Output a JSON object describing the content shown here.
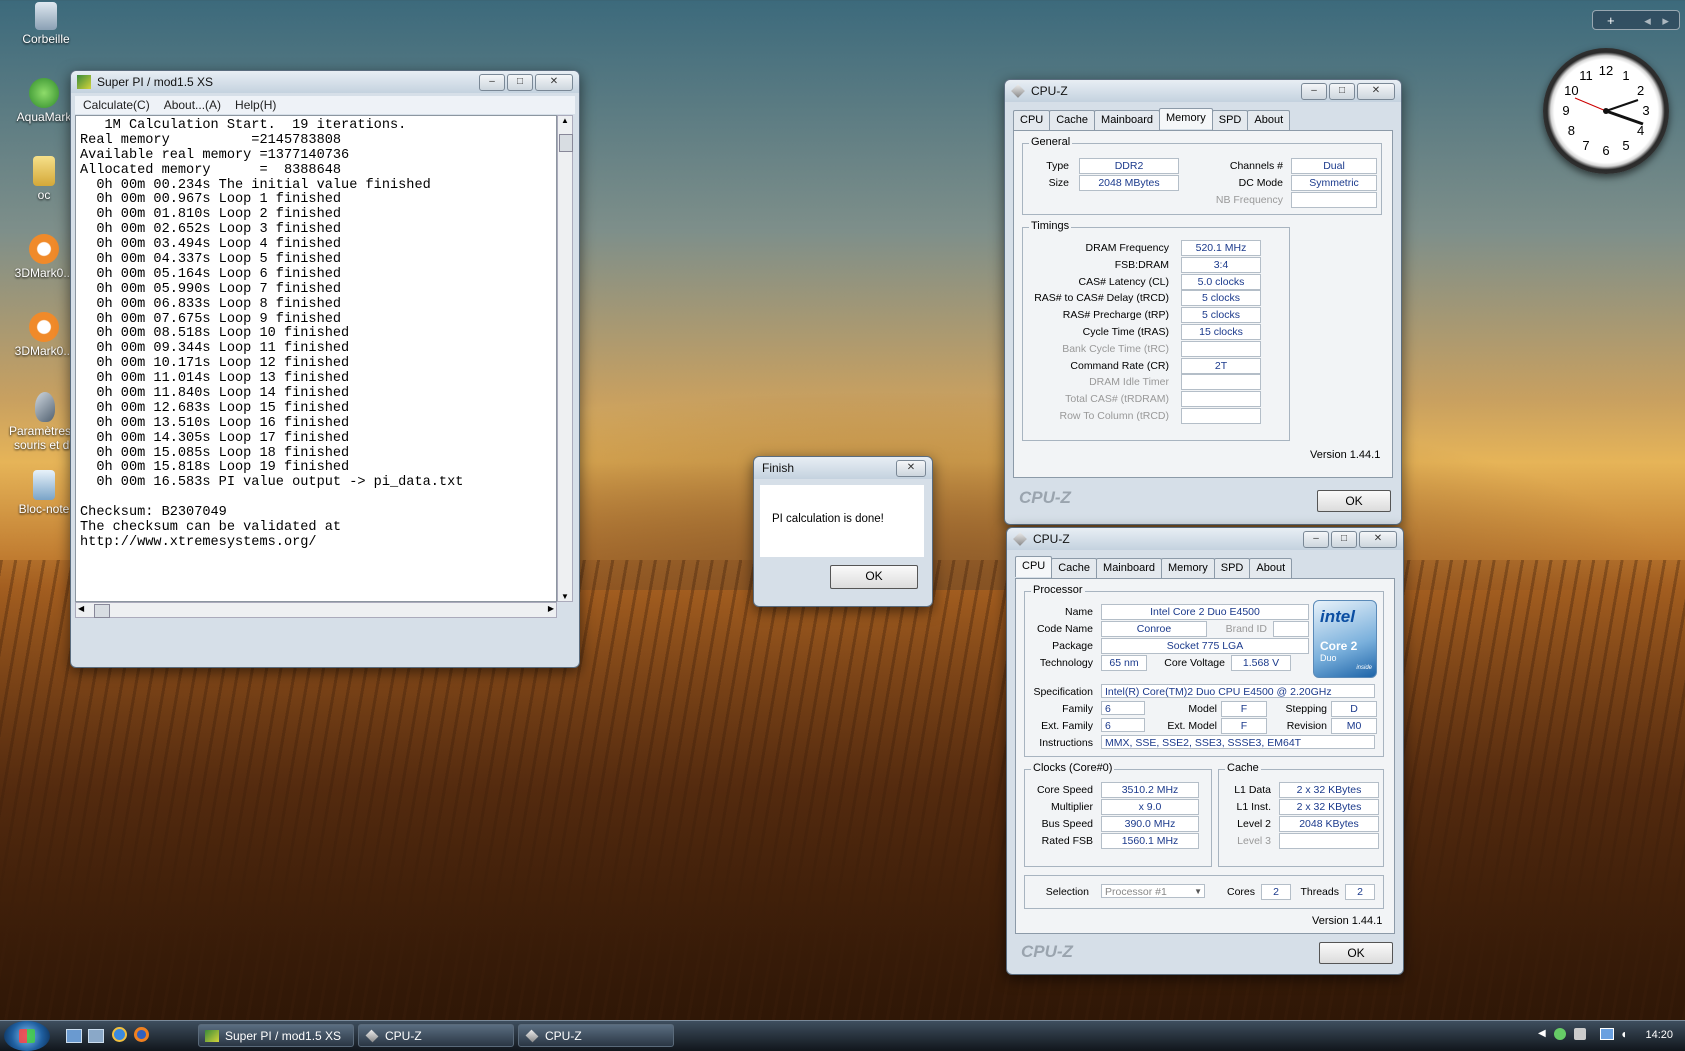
{
  "desktop": {
    "icons": [
      {
        "label": "Corbeille"
      },
      {
        "label": "AquaMark"
      },
      {
        "label": "oc"
      },
      {
        "label": "3DMark0..."
      },
      {
        "label": "3DMark0..."
      },
      {
        "label": "Paramètres d souris et du"
      },
      {
        "label": "Bloc-note"
      }
    ]
  },
  "superpi": {
    "title": "Super PI / mod1.5 XS",
    "menu": [
      "Calculate(C)",
      "About...(A)",
      "Help(H)"
    ],
    "console_lines": [
      "   1M Calculation Start.  19 iterations.",
      "Real memory          =2145783808",
      "Available real memory =1377140736",
      "Allocated memory      =  8388648",
      "  0h 00m 00.234s The initial value finished",
      "  0h 00m 00.967s Loop 1 finished",
      "  0h 00m 01.810s Loop 2 finished",
      "  0h 00m 02.652s Loop 3 finished",
      "  0h 00m 03.494s Loop 4 finished",
      "  0h 00m 04.337s Loop 5 finished",
      "  0h 00m 05.164s Loop 6 finished",
      "  0h 00m 05.990s Loop 7 finished",
      "  0h 00m 06.833s Loop 8 finished",
      "  0h 00m 07.675s Loop 9 finished",
      "  0h 00m 08.518s Loop 10 finished",
      "  0h 00m 09.344s Loop 11 finished",
      "  0h 00m 10.171s Loop 12 finished",
      "  0h 00m 11.014s Loop 13 finished",
      "  0h 00m 11.840s Loop 14 finished",
      "  0h 00m 12.683s Loop 15 finished",
      "  0h 00m 13.510s Loop 16 finished",
      "  0h 00m 14.305s Loop 17 finished",
      "  0h 00m 15.085s Loop 18 finished",
      "  0h 00m 15.818s Loop 19 finished",
      "  0h 00m 16.583s PI value output -> pi_data.txt",
      "",
      "Checksum: B2307049",
      "The checksum can be validated at",
      "http://www.xtremesystems.org/"
    ]
  },
  "finish_dialog": {
    "title": "Finish",
    "message": "PI calculation is done!",
    "ok": "OK"
  },
  "cpuz_memory": {
    "title": "CPU-Z",
    "tabs": [
      "CPU",
      "Cache",
      "Mainboard",
      "Memory",
      "SPD",
      "About"
    ],
    "general": {
      "label": "General",
      "type_label": "Type",
      "type": "DDR2",
      "size_label": "Size",
      "size": "2048 MBytes",
      "channels_label": "Channels #",
      "channels": "Dual",
      "dcmode_label": "DC Mode",
      "dcmode": "Symmetric",
      "nbfreq_label": "NB Frequency",
      "nbfreq": ""
    },
    "timings": {
      "label": "Timings",
      "rows": [
        {
          "label": "DRAM Frequency",
          "value": "520.1 MHz",
          "enabled": true
        },
        {
          "label": "FSB:DRAM",
          "value": "3:4",
          "enabled": true
        },
        {
          "label": "CAS# Latency (CL)",
          "value": "5.0 clocks",
          "enabled": true
        },
        {
          "label": "RAS# to CAS# Delay (tRCD)",
          "value": "5 clocks",
          "enabled": true
        },
        {
          "label": "RAS# Precharge (tRP)",
          "value": "5 clocks",
          "enabled": true
        },
        {
          "label": "Cycle Time (tRAS)",
          "value": "15 clocks",
          "enabled": true
        },
        {
          "label": "Bank Cycle Time (tRC)",
          "value": "",
          "enabled": false
        },
        {
          "label": "Command Rate (CR)",
          "value": "2T",
          "enabled": true
        },
        {
          "label": "DRAM Idle Timer",
          "value": "",
          "enabled": false
        },
        {
          "label": "Total CAS# (tRDRAM)",
          "value": "",
          "enabled": false
        },
        {
          "label": "Row To Column (tRCD)",
          "value": "",
          "enabled": false
        }
      ]
    },
    "version": "Version 1.44.1",
    "brand": "CPU-Z",
    "ok": "OK"
  },
  "cpuz_cpu": {
    "title": "CPU-Z",
    "tabs": [
      "CPU",
      "Cache",
      "Mainboard",
      "Memory",
      "SPD",
      "About"
    ],
    "processor": {
      "label": "Processor",
      "name_label": "Name",
      "name": "Intel Core 2 Duo E4500",
      "codename_label": "Code Name",
      "codename": "Conroe",
      "brandid_label": "Brand ID",
      "brandid": "",
      "package_label": "Package",
      "package": "Socket 775 LGA",
      "technology_label": "Technology",
      "technology": "65 nm",
      "voltage_label": "Core Voltage",
      "voltage": "1.568 V",
      "spec_label": "Specification",
      "spec": "Intel(R) Core(TM)2 Duo CPU    E4500  @ 2.20GHz",
      "family_label": "Family",
      "family": "6",
      "model_label": "Model",
      "model": "F",
      "stepping_label": "Stepping",
      "stepping": "D",
      "extfamily_label": "Ext. Family",
      "extfamily": "6",
      "extmodel_label": "Ext. Model",
      "extmodel": "F",
      "revision_label": "Revision",
      "revision": "M0",
      "instructions_label": "Instructions",
      "instructions": "MMX, SSE, SSE2, SSE3, SSSE3, EM64T"
    },
    "logo": {
      "brand": "intel",
      "line1": "Core 2",
      "line2": "Duo",
      "tag": "inside"
    },
    "clocks": {
      "label": "Clocks (Core#0)",
      "rows": [
        {
          "label": "Core Speed",
          "value": "3510.2 MHz"
        },
        {
          "label": "Multiplier",
          "value": "x 9.0"
        },
        {
          "label": "Bus Speed",
          "value": "390.0 MHz"
        },
        {
          "label": "Rated FSB",
          "value": "1560.1 MHz"
        }
      ]
    },
    "cache": {
      "label": "Cache",
      "rows": [
        {
          "label": "L1 Data",
          "value": "2 x 32 KBytes",
          "enabled": true
        },
        {
          "label": "L1 Inst.",
          "value": "2 x 32 KBytes",
          "enabled": true
        },
        {
          "label": "Level 2",
          "value": "2048 KBytes",
          "enabled": true
        },
        {
          "label": "Level 3",
          "value": "",
          "enabled": false
        }
      ]
    },
    "selection_label": "Selection",
    "selection": "Processor #1",
    "cores_label": "Cores",
    "cores": "2",
    "threads_label": "Threads",
    "threads": "2",
    "version": "Version 1.44.1",
    "brand": "CPU-Z",
    "ok": "OK"
  },
  "taskbar": {
    "items": [
      "Super PI / mod1.5 XS",
      "CPU-Z",
      "CPU-Z"
    ],
    "time": "14:20"
  },
  "gadget_clock": {
    "numbers": [
      "12",
      "1",
      "2",
      "3",
      "4",
      "5",
      "6",
      "7",
      "8",
      "9",
      "10",
      "11"
    ]
  }
}
